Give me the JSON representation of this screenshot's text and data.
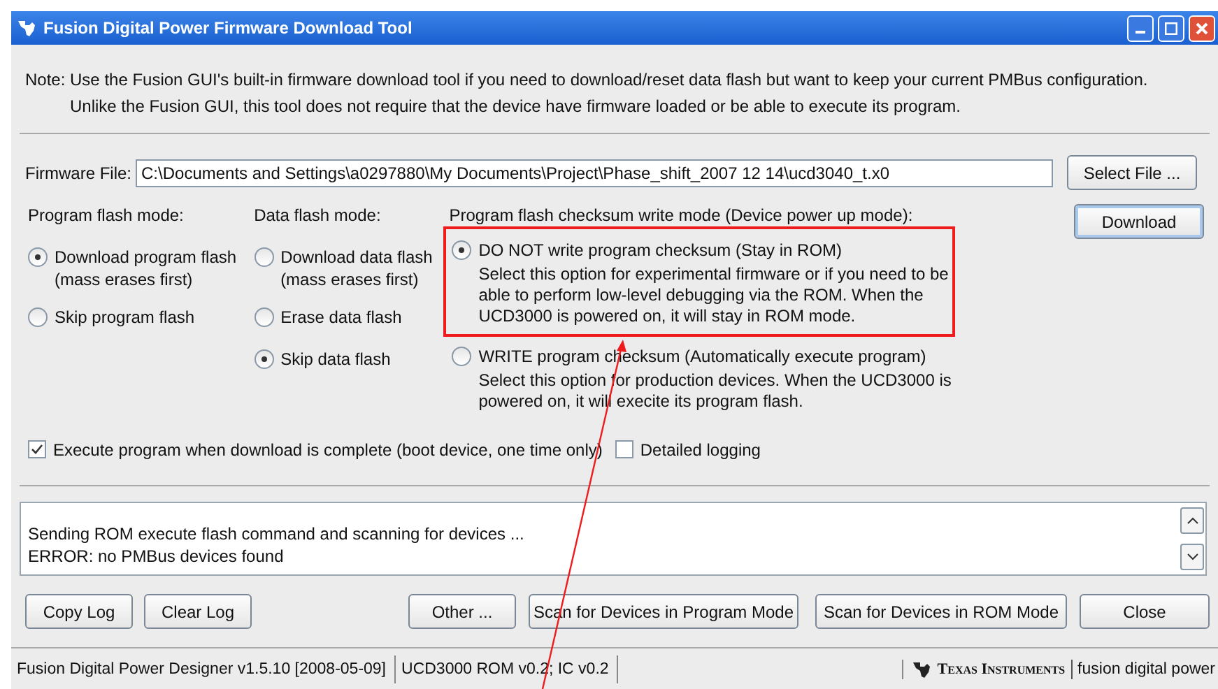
{
  "window": {
    "title": "Fusion Digital Power Firmware Download Tool"
  },
  "note": [
    "Note: Use the Fusion GUI's built-in firmware download tool if you need to download/reset data flash but want to keep your current PMBus configuration.",
    "Unlike the Fusion GUI, this tool does not require that the device have firmware loaded or be able to execute its program."
  ],
  "firmware_file": {
    "label": "Firmware File:",
    "value": "C:\\Documents and Settings\\a0297880\\My Documents\\Project\\Phase_shift_2007 12 14\\ucd3040_t.x0",
    "button": "Select File ..."
  },
  "program_flash": {
    "heading": "Program flash mode:",
    "options": [
      {
        "label": "Download program flash",
        "detail": "(mass erases first)",
        "selected": true
      },
      {
        "label": "Skip program flash",
        "selected": false
      }
    ]
  },
  "data_flash": {
    "heading": "Data flash mode:",
    "options": [
      {
        "label": "Download data flash",
        "detail": "(mass erases first)",
        "selected": false
      },
      {
        "label": "Erase data flash",
        "selected": false
      },
      {
        "label": "Skip data flash",
        "selected": true
      }
    ]
  },
  "checksum_mode": {
    "heading": "Program flash checksum write mode (Device power up mode):",
    "options": [
      {
        "label": "DO NOT write program checksum (Stay in ROM)",
        "description": "Select this option for experimental firmware or if you need to be able to perform low-level debugging via the ROM. When the UCD3000 is powered on, it will stay in ROM mode.",
        "selected": true
      },
      {
        "label": "WRITE program checksum (Automatically execute program)",
        "description": "Select this option for production devices. When the UCD3000 is powered on, it will execite its program flash.",
        "selected": false
      }
    ]
  },
  "download_button": "Download",
  "checkboxes": [
    {
      "label": "Execute program when download is complete (boot device, one time only)",
      "checked": true
    },
    {
      "label": "Detailed logging",
      "checked": false
    }
  ],
  "log": [
    "Sending ROM execute flash command and scanning for devices ...",
    "ERROR: no PMBus devices found"
  ],
  "buttons": [
    "Copy Log",
    "Clear Log",
    "Other ...",
    "Scan for Devices in Program Mode",
    "Scan for Devices in ROM Mode",
    "Close"
  ],
  "status_bar": {
    "segments": [
      "Fusion Digital Power Designer v1.5.10 [2008-05-09]",
      "UCD3000 ROM v0.2; IC v0.2"
    ],
    "brand": "Texas Instruments",
    "product": "fusion digital power"
  },
  "annotation": {
    "highlight_box": true,
    "arrow": true
  }
}
